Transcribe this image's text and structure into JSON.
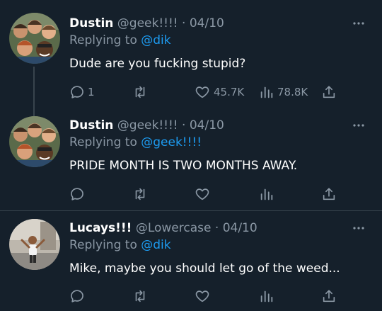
{
  "tweets": [
    {
      "name": "Dustin",
      "handle": "@geek!!!!",
      "separator": "·",
      "date": "04/10",
      "replying_prefix": "Replying to",
      "replying_to": "@dik",
      "text": "Dude are you fucking stupid?",
      "reply_count": "1",
      "retweet_count": "",
      "like_count": "45.7K",
      "view_count": "78.8K"
    },
    {
      "name": "Dustin",
      "handle": "@geek!!!!",
      "separator": "·",
      "date": "04/10",
      "replying_prefix": "Replying to",
      "replying_to": "@geek!!!!",
      "text": "PRIDE MONTH IS TWO MONTHS AWAY.",
      "reply_count": "",
      "retweet_count": "",
      "like_count": "",
      "view_count": ""
    },
    {
      "name": "Lucays!!!",
      "handle": "@Lowercase",
      "separator": "·",
      "date": "04/10",
      "replying_prefix": "Replying to",
      "replying_to": "@dik",
      "text": "Mike, maybe you should let go of the weed...",
      "reply_count": "",
      "retweet_count": "",
      "like_count": "",
      "view_count": ""
    }
  ],
  "icons": {
    "reply": "reply-icon",
    "retweet": "retweet-icon",
    "like": "like-icon",
    "views": "views-icon",
    "share": "share-icon",
    "more": "more-icon"
  },
  "colors": {
    "background": "#15202b",
    "muted": "#8b98a5",
    "link": "#1d9bf0",
    "divider": "#38444d"
  }
}
